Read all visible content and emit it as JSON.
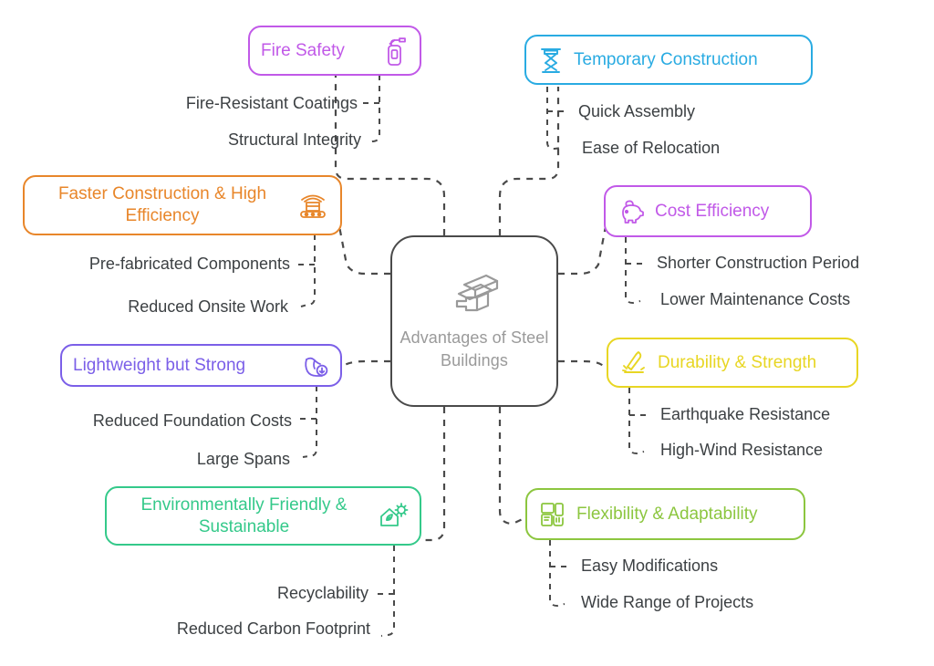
{
  "diagram": {
    "title": "Advantages of Steel Buildings Mind Map",
    "background": "#ffffff",
    "connector_color": "#4a4a4a",
    "sub_text_color": "#3c4043"
  },
  "center": {
    "label": "Advantages\nof Steel\nBuildings",
    "icon": "steel-beams-icon",
    "border_color": "#4a4a4a",
    "text_color": "#9a9a9a"
  },
  "branches": [
    {
      "id": "fire-safety",
      "label": "Fire Safety",
      "color": "#C159E8",
      "icon": "fire-extinguisher-icon",
      "icon_side": "right",
      "children": [
        "Fire-Resistant Coatings",
        "Structural Integrity"
      ]
    },
    {
      "id": "temporary-construction",
      "label": "Temporary Construction",
      "color": "#29ABE2",
      "icon": "scissor-lift-icon",
      "icon_side": "left",
      "children": [
        "Quick Assembly",
        "Ease of Relocation"
      ]
    },
    {
      "id": "faster-construction",
      "label": "Faster Construction & High\nEfficiency",
      "color": "#E8862A",
      "icon": "conveyor-factory-icon",
      "icon_side": "right",
      "children": [
        "Pre-fabricated Components",
        "Reduced Onsite Work"
      ]
    },
    {
      "id": "cost-efficiency",
      "label": "Cost Efficiency",
      "color": "#C159E8",
      "icon": "piggy-bank-icon",
      "icon_side": "left",
      "children": [
        "Shorter Construction Period",
        "Lower Maintenance Costs"
      ]
    },
    {
      "id": "lightweight-but-strong",
      "label": "Lightweight but Strong",
      "color": "#7B5FE8",
      "icon": "flexed-bicep-icon",
      "icon_side": "right",
      "children": [
        "Reduced Foundation Costs",
        "Large Spans"
      ]
    },
    {
      "id": "durability-strength",
      "label": "Durability & Strength",
      "color": "#E8D623",
      "icon": "chisel-hardness-icon",
      "icon_side": "left",
      "children": [
        "Earthquake Resistance",
        "High-Wind Resistance"
      ]
    },
    {
      "id": "environmentally-friendly",
      "label": "Environmentally Friendly &\nSustainable",
      "color": "#34C98A",
      "icon": "eco-house-leaf-icon",
      "icon_side": "right",
      "children": [
        "Recyclability",
        "Reduced Carbon Footprint"
      ]
    },
    {
      "id": "flexibility-adaptability",
      "label": "Flexibility & Adaptability",
      "color": "#8CC63F",
      "icon": "adaptable-devices-icon",
      "icon_side": "left",
      "children": [
        "Easy Modifications",
        "Wide Range of Projects"
      ]
    }
  ]
}
